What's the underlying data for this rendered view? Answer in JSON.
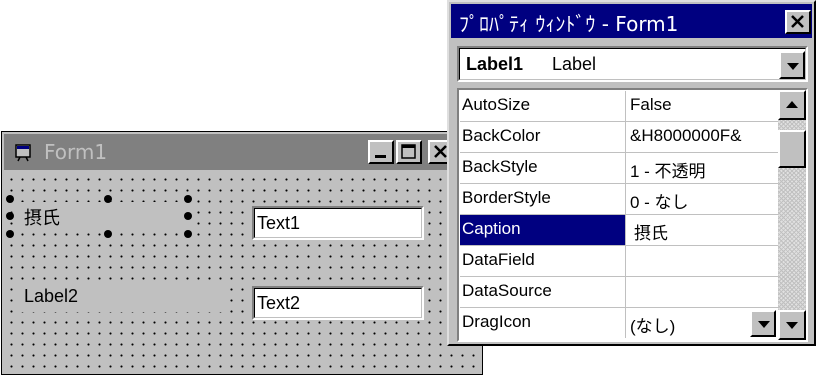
{
  "form_window": {
    "title": "Form1",
    "controls": {
      "label1_text": "摂氏",
      "label2_text": "Label2",
      "text1_value": "Text1",
      "text2_value": "Text2"
    }
  },
  "properties_window": {
    "title": "ﾌﾟﾛﾊﾟﾃｨ ｳｨﾝﾄﾞｳ - Form1",
    "object_selector": {
      "name": "Label1",
      "type": "Label"
    },
    "properties": [
      {
        "name": "AutoSize",
        "value": "False"
      },
      {
        "name": "BackColor",
        "value": "&H8000000F&"
      },
      {
        "name": "BackStyle",
        "value": "1 - 不透明"
      },
      {
        "name": "BorderStyle",
        "value": "0 - なし"
      },
      {
        "name": "Caption",
        "value": "摂氏",
        "selected": true
      },
      {
        "name": "DataField",
        "value": ""
      },
      {
        "name": "DataSource",
        "value": ""
      },
      {
        "name": "DragIcon",
        "value": "(なし)"
      }
    ]
  },
  "colors": {
    "active_titlebar": "#000080",
    "inactive_titlebar": "#808080",
    "button_face": "#c0c0c0",
    "selection": "#000080"
  }
}
